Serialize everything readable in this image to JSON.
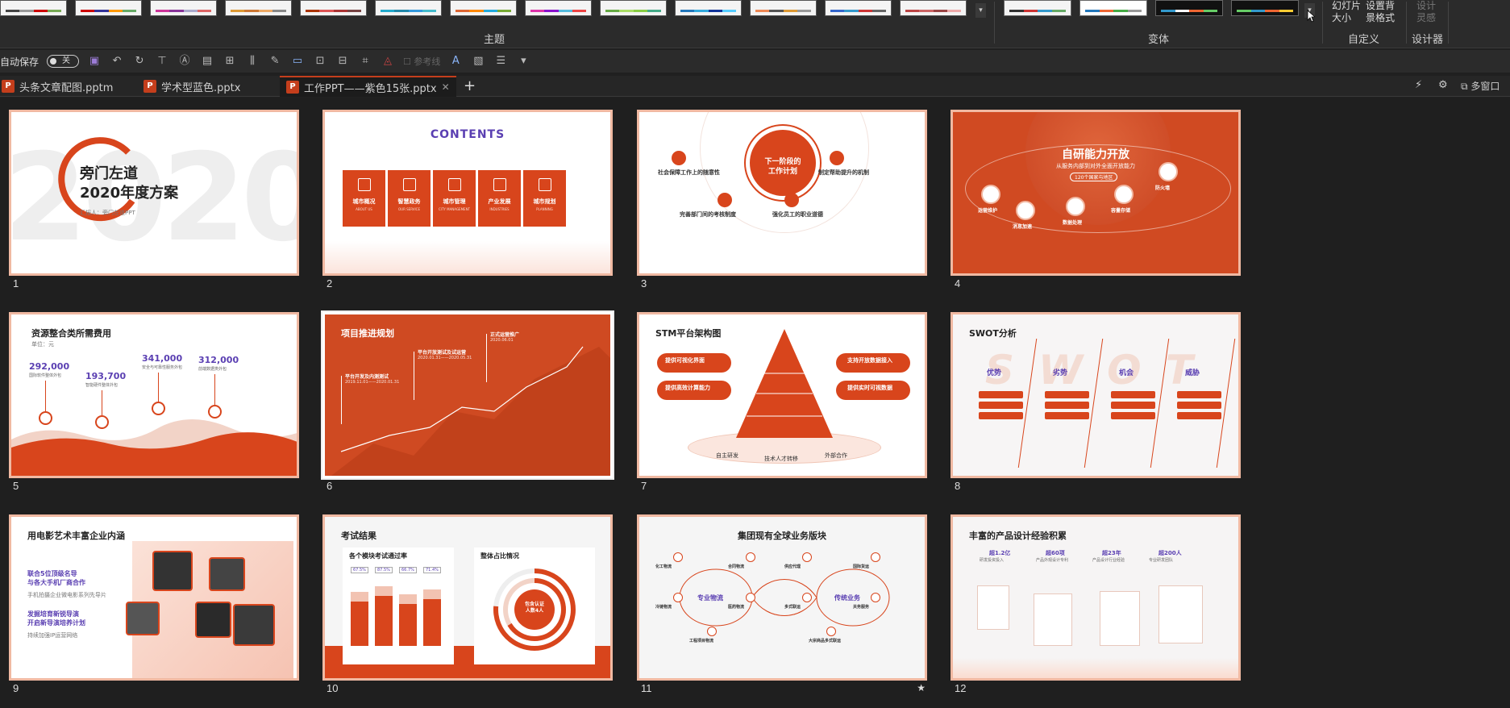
{
  "ribbon": {
    "themes_label": "主题",
    "variants_label": "变体",
    "customize_label": "自定义",
    "designer_label": "设计器",
    "slide_size_label": "幻灯片\n大小",
    "format_bg_label": "设置背\n景格式",
    "design_ideas_label": "设计\n灵感",
    "themes": [
      {
        "colors": [
          "#444",
          "#999",
          "#c00",
          "#7a5"
        ]
      },
      {
        "colors": [
          "#c00",
          "#339",
          "#f90",
          "#6a6"
        ]
      },
      {
        "colors": [
          "#c39",
          "#839",
          "#aac",
          "#d66"
        ]
      },
      {
        "colors": [
          "#d93",
          "#c73",
          "#ea6",
          "#888"
        ]
      },
      {
        "colors": [
          "#a30",
          "#d55",
          "#a33",
          "#744"
        ]
      },
      {
        "colors": [
          "#2ac",
          "#28a",
          "#39d",
          "#4bc"
        ]
      },
      {
        "colors": [
          "#d63",
          "#f80",
          "#2ad",
          "#7a3"
        ]
      },
      {
        "colors": [
          "#d3a",
          "#81c",
          "#5bd",
          "#e44"
        ]
      },
      {
        "colors": [
          "#6a4",
          "#ad6",
          "#8c4",
          "#4a8"
        ]
      },
      {
        "colors": [
          "#27b",
          "#3ad",
          "#139",
          "#5cf"
        ]
      },
      {
        "colors": [
          "#e85",
          "#555",
          "#d93",
          "#999"
        ]
      },
      {
        "colors": [
          "#36c",
          "#39c",
          "#c33",
          "#666"
        ]
      },
      {
        "colors": [
          "#b44",
          "#c66",
          "#944",
          "#eaa"
        ]
      }
    ],
    "variants": [
      {
        "bg": "#f4f4f4",
        "colors": [
          "#333",
          "#c33",
          "#39c",
          "#6a6"
        ]
      },
      {
        "bg": "#ffffff",
        "colors": [
          "#27b",
          "#e63",
          "#4a4",
          "#999"
        ]
      },
      {
        "bg": "#111111",
        "colors": [
          "#39c",
          "#fff",
          "#e63",
          "#6c6"
        ]
      },
      {
        "bg": "#111111",
        "colors": [
          "#6c6",
          "#39c",
          "#e63",
          "#fc3"
        ]
      }
    ]
  },
  "qat": {
    "autosave_label": "自动保存",
    "autosave_state": "关",
    "guides_label": "参考线"
  },
  "tabs": [
    {
      "name": "头条文章配图.pptm"
    },
    {
      "name": "学术型蓝色.pptx"
    },
    {
      "name": "工作PPT——紫色15张.pptx",
      "active": true
    }
  ],
  "tabs_right": {
    "multi_window_label": "多窗口"
  },
  "slides": [
    {
      "num": "1",
      "title": "旁门左道\n2020年度方案",
      "subtitle": "汇报人：旁门左道PPT",
      "bg_text": "2020"
    },
    {
      "num": "2",
      "title": "CONTENTS",
      "items": [
        {
          "cn": "城市概况",
          "en": "ABOUT US"
        },
        {
          "cn": "智慧政务",
          "en": "OUR SERVICE"
        },
        {
          "cn": "城市管理",
          "en": "CITY MANAGEMENT"
        },
        {
          "cn": "产业发展",
          "en": "INDUSTRIES"
        },
        {
          "cn": "城市规划",
          "en": "PLANNING"
        }
      ]
    },
    {
      "num": "3",
      "center": "下一阶段的\n工作计划",
      "items": [
        "社会保障工作上的随意性",
        "制定帮助提升的机制",
        "完善部门间的考核制度",
        "强化员工的职业道德"
      ]
    },
    {
      "num": "4",
      "title": "自研能力开放",
      "subtitle": "从服务内部到对外全面开放能力",
      "badge": "120个国家与地区",
      "items": [
        "运营维护",
        "消息加速",
        "数据处理",
        "容量存储",
        "防火墙"
      ]
    },
    {
      "num": "5",
      "title": "资源整合类所需费用",
      "unit": "单位：元",
      "values": [
        {
          "v": "292,000",
          "d": "国际软件整体外包"
        },
        {
          "v": "193,700",
          "d": "智能硬件整体外包"
        },
        {
          "v": "341,000",
          "d": "安全与可靠性服务外包"
        },
        {
          "v": "312,000",
          "d": "前端数据类外包"
        }
      ]
    },
    {
      "num": "6",
      "title": "项目推进规划",
      "milestones": [
        {
          "t": "平台开发及内测测试",
          "d": "2019.11.01——2020.01.31"
        },
        {
          "t": "平台开放测试及试运营",
          "d": "2020.01.31——2020.05.31"
        },
        {
          "t": "正式运营推广",
          "d": "2020.06.01"
        }
      ]
    },
    {
      "num": "7",
      "title": "STM平台架构图",
      "left": [
        "提供可视化界面",
        "提供高效计算能力"
      ],
      "right": [
        "支持开放数据接入",
        "提供实时可视数据"
      ],
      "bottom": [
        "自主研发",
        "技术人才转移",
        "外部合作"
      ]
    },
    {
      "num": "8",
      "title": "SWOT分析",
      "bg_text": "SWOT",
      "cols": [
        "优势",
        "劣势",
        "机会",
        "威胁"
      ]
    },
    {
      "num": "9",
      "title": "用电影艺术丰富企业内涵",
      "p1": "联合5位顶级名导\n与各大手机厂商合作",
      "p1s": "手机拍摄企业微电影系列先导片",
      "p2": "发掘培育新锐导演\n开启新导演培养计划",
      "p2s": "持续加强IP运营网络"
    },
    {
      "num": "10",
      "title": "考试结果",
      "left_title": "各个模块考试通过率",
      "right_title": "整体占比情况",
      "pcts": [
        "67.5%",
        "87.5%",
        "66.7%",
        "71.4%"
      ],
      "donut_center": "包含认证\n人数4人"
    },
    {
      "num": "11",
      "title": "集团现有全球业务版块",
      "left_center": "专业物流",
      "right_center": "传统业务",
      "left_items": [
        "化工物流",
        "冷链物流",
        "合同物流",
        "医药物流",
        "工程项目物流"
      ],
      "right_items": [
        "供应代理",
        "多式联运",
        "国际货运",
        "关务服务",
        "大宗商品多式联运"
      ],
      "starred": true
    },
    {
      "num": "12",
      "title": "丰富的产品设计经验积累",
      "stats": [
        {
          "v": "超1.2亿",
          "d": "研发投资投入"
        },
        {
          "v": "超60项",
          "d": "产品外观设计专利"
        },
        {
          "v": "超23年",
          "d": "产品设计行业经验"
        },
        {
          "v": "超200人",
          "d": "专业研发团队"
        }
      ]
    }
  ]
}
